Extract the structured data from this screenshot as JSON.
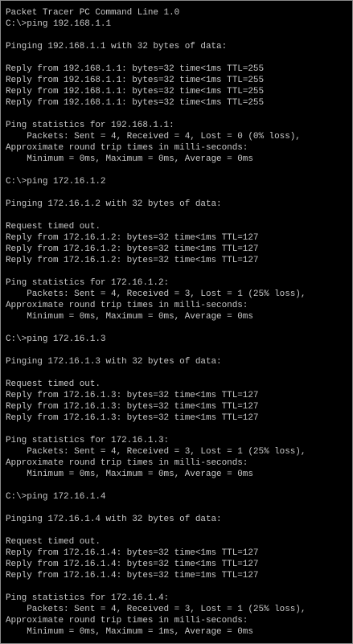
{
  "terminal": {
    "lines": [
      "Packet Tracer PC Command Line 1.0",
      "C:\\>ping 192.168.1.1",
      "",
      "Pinging 192.168.1.1 with 32 bytes of data:",
      "",
      "Reply from 192.168.1.1: bytes=32 time<1ms TTL=255",
      "Reply from 192.168.1.1: bytes=32 time<1ms TTL=255",
      "Reply from 192.168.1.1: bytes=32 time<1ms TTL=255",
      "Reply from 192.168.1.1: bytes=32 time<1ms TTL=255",
      "",
      "Ping statistics for 192.168.1.1:",
      "    Packets: Sent = 4, Received = 4, Lost = 0 (0% loss),",
      "Approximate round trip times in milli-seconds:",
      "    Minimum = 0ms, Maximum = 0ms, Average = 0ms",
      "",
      "C:\\>ping 172.16.1.2",
      "",
      "Pinging 172.16.1.2 with 32 bytes of data:",
      "",
      "Request timed out.",
      "Reply from 172.16.1.2: bytes=32 time<1ms TTL=127",
      "Reply from 172.16.1.2: bytes=32 time<1ms TTL=127",
      "Reply from 172.16.1.2: bytes=32 time<1ms TTL=127",
      "",
      "Ping statistics for 172.16.1.2:",
      "    Packets: Sent = 4, Received = 3, Lost = 1 (25% loss),",
      "Approximate round trip times in milli-seconds:",
      "    Minimum = 0ms, Maximum = 0ms, Average = 0ms",
      "",
      "C:\\>ping 172.16.1.3",
      "",
      "Pinging 172.16.1.3 with 32 bytes of data:",
      "",
      "Request timed out.",
      "Reply from 172.16.1.3: bytes=32 time<1ms TTL=127",
      "Reply from 172.16.1.3: bytes=32 time<1ms TTL=127",
      "Reply from 172.16.1.3: bytes=32 time<1ms TTL=127",
      "",
      "Ping statistics for 172.16.1.3:",
      "    Packets: Sent = 4, Received = 3, Lost = 1 (25% loss),",
      "Approximate round trip times in milli-seconds:",
      "    Minimum = 0ms, Maximum = 0ms, Average = 0ms",
      "",
      "C:\\>ping 172.16.1.4",
      "",
      "Pinging 172.16.1.4 with 32 bytes of data:",
      "",
      "Request timed out.",
      "Reply from 172.16.1.4: bytes=32 time<1ms TTL=127",
      "Reply from 172.16.1.4: bytes=32 time<1ms TTL=127",
      "Reply from 172.16.1.4: bytes=32 time=1ms TTL=127",
      "",
      "Ping statistics for 172.16.1.4:",
      "    Packets: Sent = 4, Received = 3, Lost = 1 (25% loss),",
      "Approximate round trip times in milli-seconds:",
      "    Minimum = 0ms, Maximum = 1ms, Average = 0ms"
    ]
  },
  "colors": {
    "background": "#000000",
    "text": "#c8c8c8",
    "border": "#8a8a8a"
  }
}
